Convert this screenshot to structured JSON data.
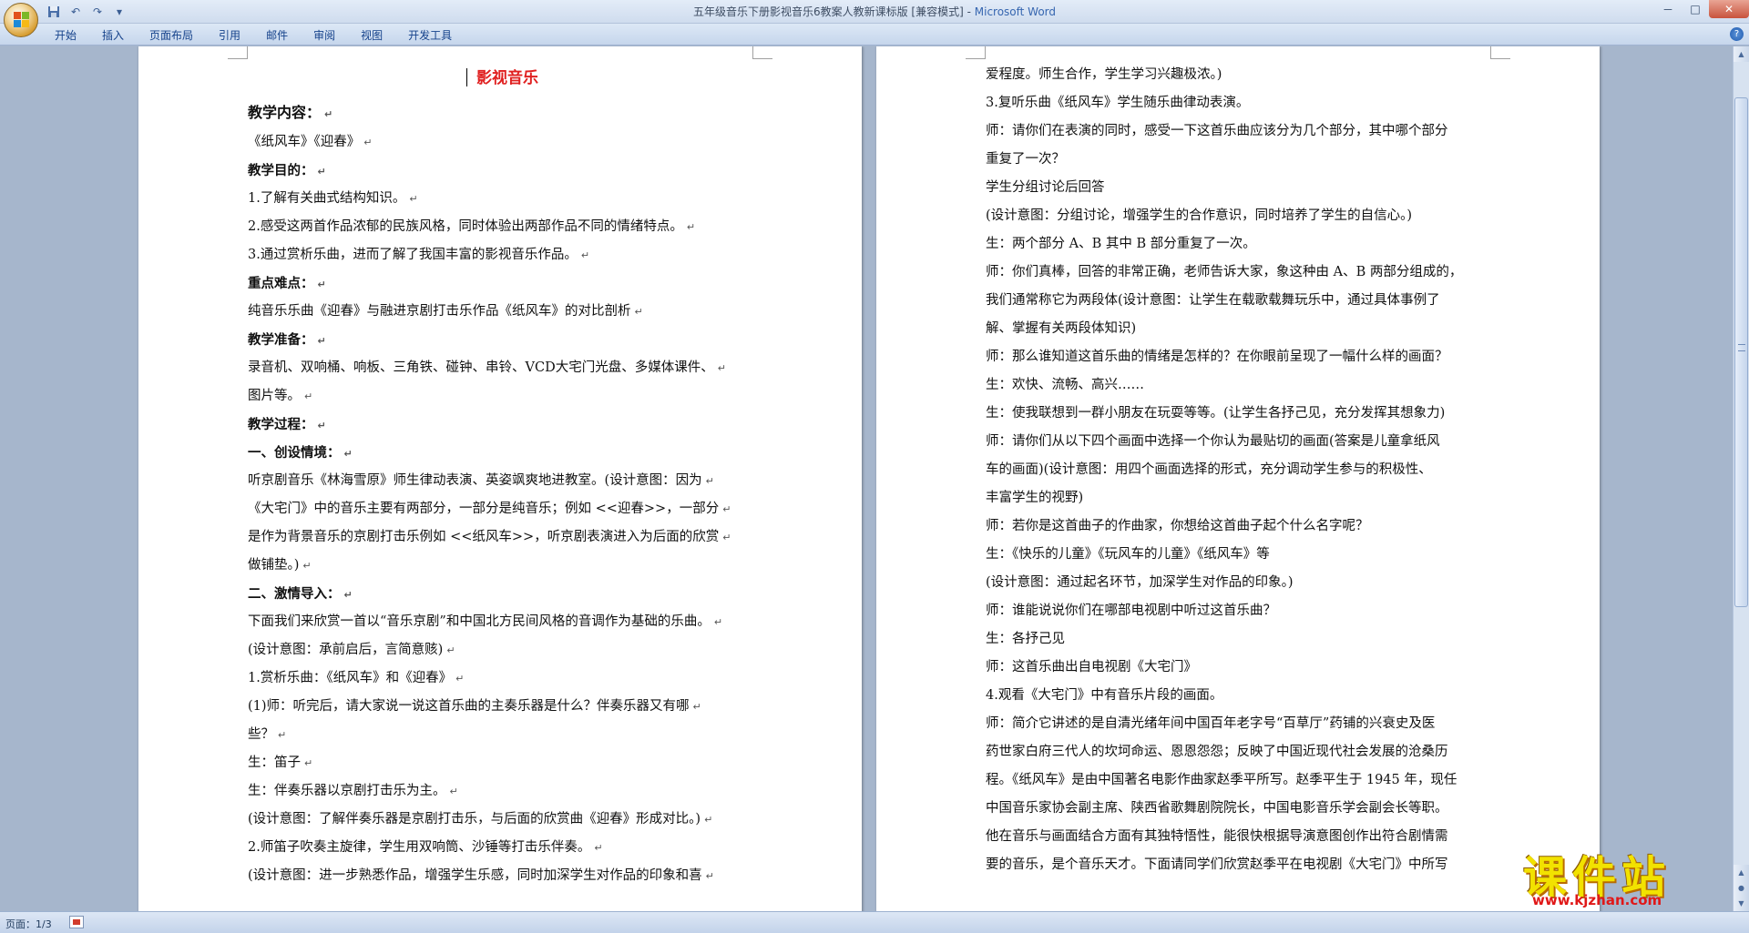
{
  "window": {
    "title_doc": "五年级音乐下册影视音乐6教案人教新课标版 [兼容模式] - ",
    "title_app": "Microsoft Word",
    "minimize": "－",
    "maximize": "□",
    "close": "✕"
  },
  "qat": {
    "save_icon": "save-icon",
    "undo": "↶",
    "redo": "↷",
    "customize": "▾"
  },
  "ribbon": {
    "tabs": [
      "开始",
      "插入",
      "页面布局",
      "引用",
      "邮件",
      "审阅",
      "视图",
      "开发工具"
    ],
    "help": "?"
  },
  "page1": {
    "title": "影视音乐",
    "lines": [
      {
        "text": "教学内容：",
        "style": "heading"
      },
      {
        "text": "《纸风车》《迎春》",
        "style": ""
      },
      {
        "text": "教学目的：",
        "style": "bold"
      },
      {
        "text": "1.了解有关曲式结构知识。",
        "style": ""
      },
      {
        "text": "2.感受这两首作品浓郁的民族风格，同时体验出两部作品不同的情绪特点。",
        "style": ""
      },
      {
        "text": "3.通过赏析乐曲，进而了解了我国丰富的影视音乐作品。",
        "style": ""
      },
      {
        "text": "重点难点：",
        "style": "bold"
      },
      {
        "text": "纯音乐乐曲《迎春》与融进京剧打击乐作品《纸风车》的对比剖析",
        "style": ""
      },
      {
        "text": "教学准备：",
        "style": "bold"
      },
      {
        "text": "录音机、双响桶、响板、三角铁、碰钟、串铃、VCD大宅门光盘、多媒体课件、",
        "style": ""
      },
      {
        "text": "图片等。",
        "style": ""
      },
      {
        "text": "教学过程：",
        "style": "bold"
      },
      {
        "text": "一、创设情境：",
        "style": "bold"
      },
      {
        "text": "听京剧音乐《林海雪原》师生律动表演、英姿飒爽地进教室。(设计意图：因为",
        "style": ""
      },
      {
        "text": "《大宅门》中的音乐主要有两部分，一部分是纯音乐；例如 <<迎春>>，一部分",
        "style": ""
      },
      {
        "text": "是作为背景音乐的京剧打击乐例如 <<纸风车>>，听京剧表演进入为后面的欣赏",
        "style": ""
      },
      {
        "text": "做铺垫。)",
        "style": ""
      },
      {
        "text": "二、激情导入：",
        "style": "bold"
      },
      {
        "text": "下面我们来欣赏一首以“音乐京剧”和中国北方民间风格的音调作为基础的乐曲。",
        "style": ""
      },
      {
        "text": "(设计意图：承前启后，言简意赅)",
        "style": ""
      },
      {
        "text": "1.赏析乐曲：《纸风车》和《迎春》",
        "style": ""
      },
      {
        "text": "(1)师：听完后，请大家说一说这首乐曲的主奏乐器是什么？伴奏乐器又有哪",
        "style": ""
      },
      {
        "text": "些？",
        "style": ""
      },
      {
        "text": "生：笛子",
        "style": ""
      },
      {
        "text": "生：伴奏乐器以京剧打击乐为主。",
        "style": ""
      },
      {
        "text": "(设计意图：了解伴奏乐器是京剧打击乐，与后面的欣赏曲《迎春》形成对比。)",
        "style": ""
      },
      {
        "text": "2.师笛子吹奏主旋律，学生用双响筒、沙锤等打击乐伴奏。",
        "style": ""
      },
      {
        "text": "(设计意图：进一步熟悉作品，增强学生乐感，同时加深学生对作品的印象和喜",
        "style": ""
      }
    ]
  },
  "page2": {
    "lines": [
      "爱程度。师生合作，学生学习兴趣极浓。)",
      "3.复听乐曲《纸风车》学生随乐曲律动表演。",
      "师：请你们在表演的同时，感受一下这首乐曲应该分为几个部分，其中哪个部分",
      "重复了一次？",
      "学生分组讨论后回答",
      "(设计意图：分组讨论，增强学生的合作意识，同时培养了学生的自信心。)",
      "生：两个部分 A、B 其中 B 部分重复了一次。",
      "师：你们真棒，回答的非常正确，老师告诉大家，象这种由 A、B 两部分组成的，",
      "我们通常称它为两段体(设计意图：让学生在载歌载舞玩乐中，通过具体事例了",
      "解、掌握有关两段体知识)",
      "师：那么谁知道这首乐曲的情绪是怎样的？在你眼前呈现了一幅什么样的画面？",
      "生：欢快、流畅、高兴……",
      "生：使我联想到一群小朋友在玩耍等等。(让学生各抒己见，充分发挥其想象力)",
      "师：请你们从以下四个画面中选择一个你认为最贴切的画面(答案是儿童拿纸风",
      "车的画面)(设计意图：用四个画面选择的形式，充分调动学生参与的积极性、",
      "丰富学生的视野)",
      "师：若你是这首曲子的作曲家，你想给这首曲子起个什么名字呢？",
      "生：《快乐的儿童》《玩风车的儿童》《纸风车》等",
      "(设计意图：通过起名环节，加深学生对作品的印象。)",
      "师：谁能说说你们在哪部电视剧中听过这首乐曲？",
      "生：各抒己见",
      "师：这首乐曲出自电视剧《大宅门》",
      "4.观看《大宅门》中有音乐片段的画面。",
      "师：简介它讲述的是自清光绪年间中国百年老字号“百草厅”药铺的兴衰史及医",
      "药世家白府三代人的坎坷命运、恩恩怨怨；反映了中国近现代社会发展的沧桑历",
      "程。《纸风车》是由中国著名电影作曲家赵季平所写。赵季平生于 1945 年，现任",
      "中国音乐家协会副主席、陕西省歌舞剧院院长，中国电影音乐学会副会长等职。",
      "他在音乐与画面结合方面有其独特悟性，能很快根据导演意图创作出符合剧情需",
      "要的音乐，是个音乐天才。下面请同学们欣赏赵季平在电视剧《大宅门》中所写"
    ]
  },
  "status": {
    "page_count": "页面：1/3"
  },
  "watermark": {
    "text": "课件站",
    "url": "www.kjzhan.com"
  },
  "colors": {
    "title_red": "#e02020",
    "ribbon_blue": "#15428b",
    "app_name_blue": "#3666b0"
  }
}
